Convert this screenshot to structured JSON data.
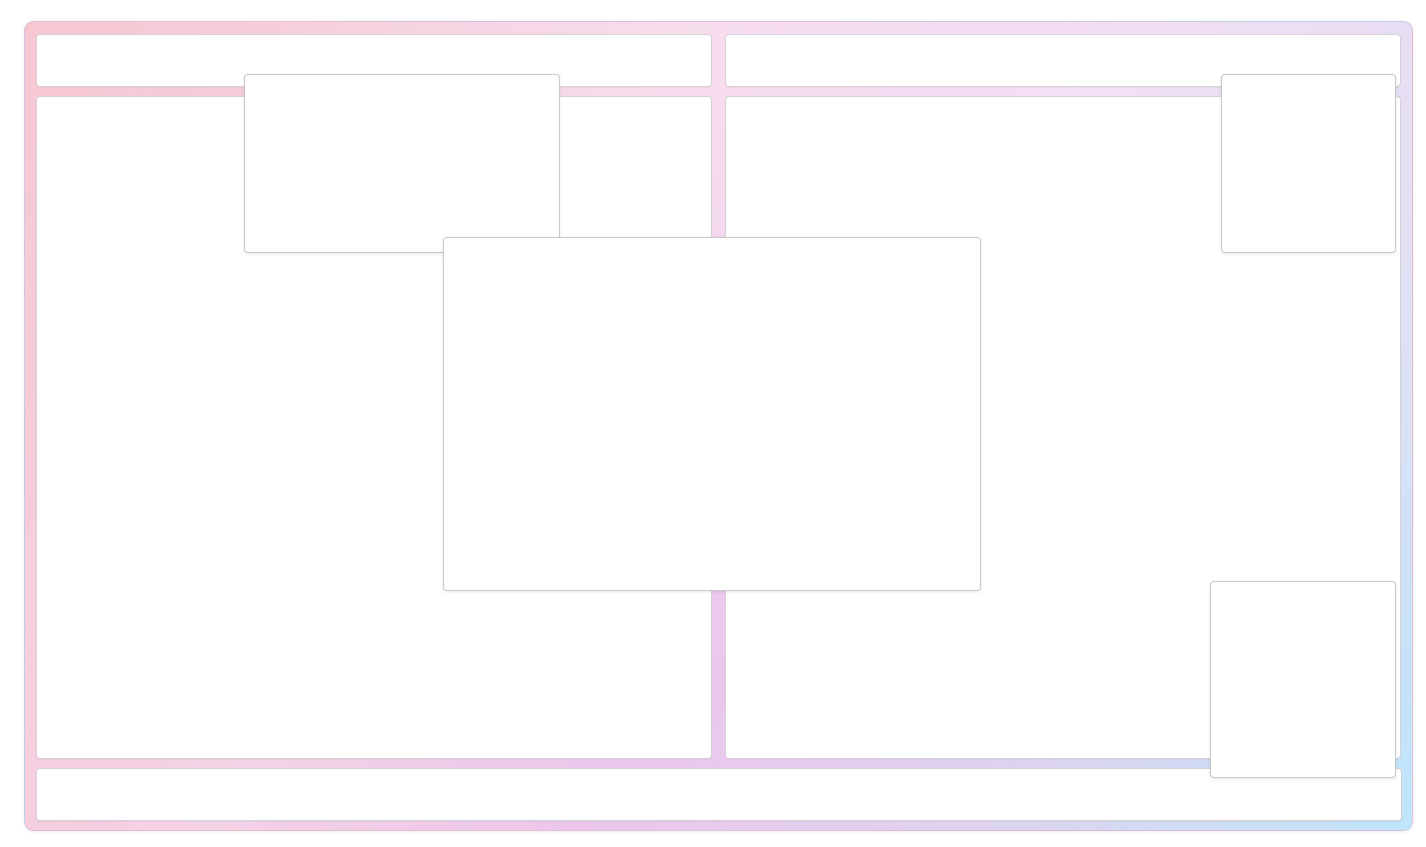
{
  "app": {
    "title": ""
  },
  "left_header": {
    "text": ""
  },
  "right_header": {
    "text": ""
  },
  "left_main": {
    "input": {
      "value": "",
      "placeholder": ""
    }
  },
  "right_main": {
    "text": ""
  },
  "footer": {
    "text": ""
  },
  "overlays": {
    "top_left": {
      "text": ""
    },
    "center": {
      "text": ""
    },
    "top_right": {
      "text": ""
    },
    "bottom_right": {
      "text": ""
    }
  },
  "theme": {
    "gradient_pink": "#f7c8d2",
    "gradient_purple": "#ecc6ec",
    "gradient_blue": "#bfe6fb",
    "panel_white": "#ffffff",
    "panel_border": "#d6d1d6"
  }
}
